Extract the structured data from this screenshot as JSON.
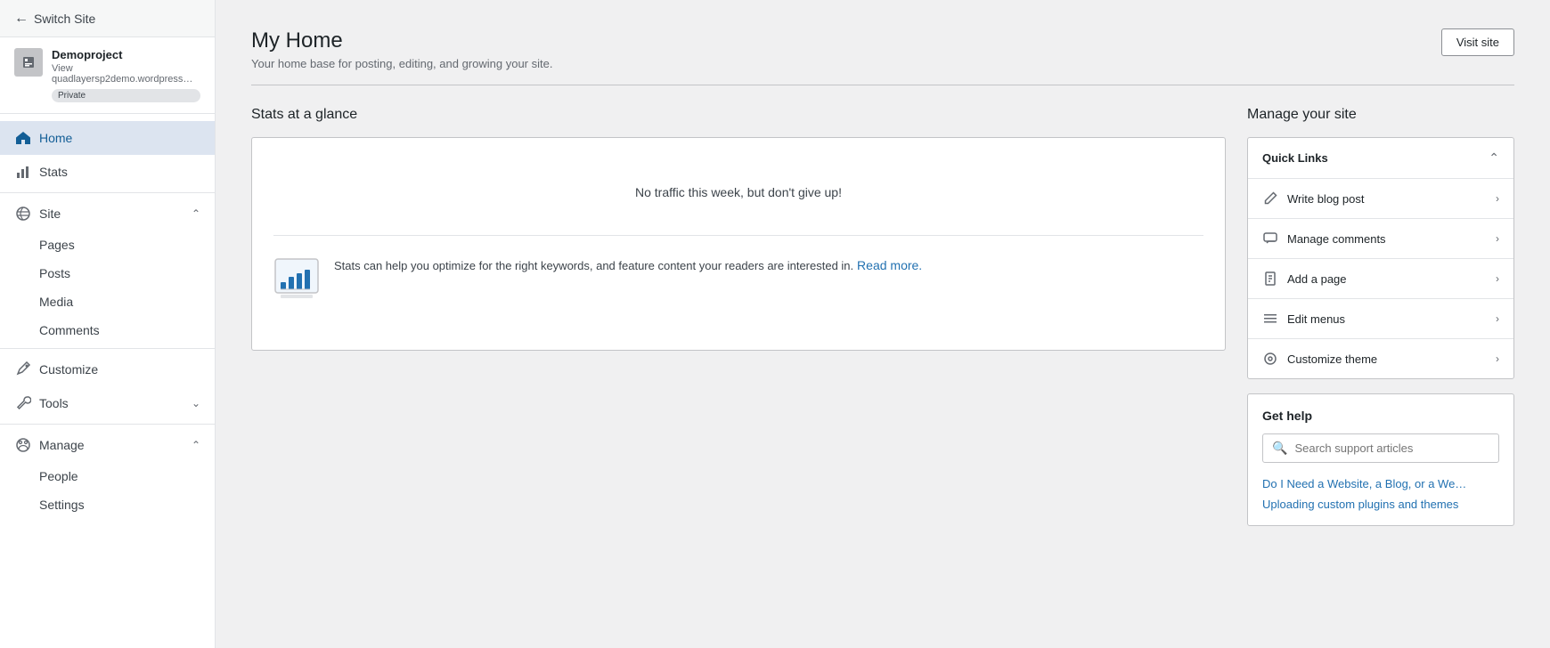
{
  "sidebar": {
    "switch_site_label": "Switch Site",
    "site": {
      "name": "Demoproject",
      "url": "View quadlayersp2demo.wordpress…",
      "badge": "Private"
    },
    "nav_items": [
      {
        "id": "home",
        "label": "Home",
        "icon": "home",
        "active": true
      },
      {
        "id": "stats",
        "label": "Stats",
        "icon": "stats"
      },
      {
        "id": "site",
        "label": "Site",
        "icon": "site",
        "expandable": true,
        "expanded": true
      },
      {
        "id": "customize",
        "label": "Customize",
        "icon": "customize"
      },
      {
        "id": "tools",
        "label": "Tools",
        "icon": "tools",
        "expandable": true
      },
      {
        "id": "manage",
        "label": "Manage",
        "icon": "manage",
        "expandable": true,
        "expanded": true
      }
    ],
    "site_sub_items": [
      "Pages",
      "Posts",
      "Media",
      "Comments"
    ],
    "manage_sub_items": [
      "People",
      "Settings"
    ]
  },
  "header": {
    "title": "My Home",
    "subtitle": "Your home base for posting, editing, and growing your site.",
    "visit_site_label": "Visit site"
  },
  "stats": {
    "title": "Stats at a glance",
    "no_traffic_msg": "No traffic this week, but don't give up!",
    "promo_text": "Stats can help you optimize for the right keywords, and feature content your readers are interested in.",
    "read_more_label": "Read more."
  },
  "manage_site": {
    "title": "Manage your site",
    "quick_links": {
      "label": "Quick Links",
      "items": [
        {
          "id": "write-blog-post",
          "label": "Write blog post",
          "icon": "pencil"
        },
        {
          "id": "manage-comments",
          "label": "Manage comments",
          "icon": "comment"
        },
        {
          "id": "add-page",
          "label": "Add a page",
          "icon": "document"
        },
        {
          "id": "edit-menus",
          "label": "Edit menus",
          "icon": "menus"
        },
        {
          "id": "customize-theme",
          "label": "Customize theme",
          "icon": "brush"
        }
      ]
    },
    "get_help": {
      "title": "Get help",
      "search_placeholder": "Search support articles",
      "help_links": [
        "Do I Need a Website, a Blog, or a We…",
        "Uploading custom plugins and themes"
      ]
    }
  }
}
